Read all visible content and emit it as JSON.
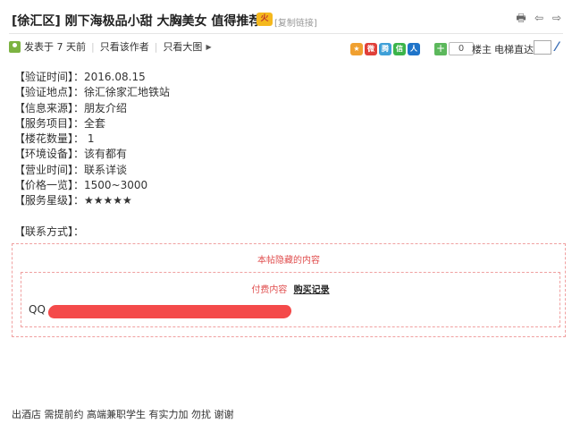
{
  "post": {
    "title": "[徐汇区] 刚下海极品小甜 大胸美女 值得推荐",
    "hot_badge": "火",
    "copy_link": "[复制链接]"
  },
  "meta": {
    "posted": "发表于 7 天前",
    "author_only": "只看该作者",
    "large_image": "只看大图"
  },
  "share": {
    "icons": [
      "qzone-icon",
      "weibo-icon",
      "tencent-weibo-icon",
      "wechat-icon",
      "renren-icon"
    ],
    "count": "0",
    "floor": "楼主",
    "elevator": "电梯直达"
  },
  "info": [
    "【验证时间】：2016.08.15",
    "【验证地点】：徐汇徐家汇地铁站",
    "【信息来源】：朋友介绍",
    "【服务项目】：全套",
    "【楼花数量】： 1",
    "【环境设备】：该有都有",
    "【营业时间】：联系详谈",
    "【价格一览】：1500~3000",
    "【服务星级】：★★★★★"
  ],
  "contact": "【联系方式】：",
  "hidden": {
    "title": "本帖隐藏的内容",
    "paid_label": "付费内容",
    "buy_link": "购买记录",
    "qq_label": "QQ"
  },
  "footer_note": "出酒店 需提前约 高端兼职学生 有实力加 勿扰 谢谢",
  "colors": {
    "accent_red": "#e04e4e",
    "redaction": "#f33b3b"
  }
}
